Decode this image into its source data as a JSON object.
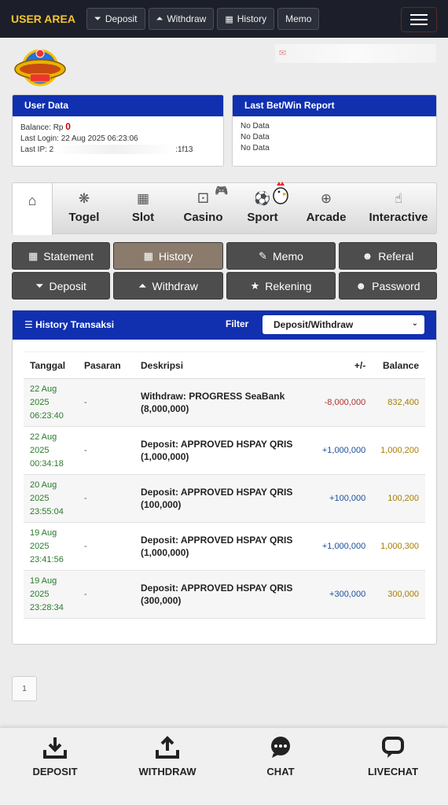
{
  "topbar": {
    "brand": "USER AREA",
    "buttons": [
      {
        "label": "Deposit",
        "icon": "deposit-icon"
      },
      {
        "label": "Withdraw",
        "icon": "withdraw-icon"
      },
      {
        "label": "History",
        "icon": "history-icon"
      },
      {
        "label": "Memo",
        "icon": ""
      }
    ]
  },
  "user_data": {
    "title": "User Data",
    "balance_label": "Balance: Rp",
    "balance_value": "0",
    "last_login": "Last Login: 22 Aug 2025 06:23:06",
    "last_ip_label": "Last IP: 2",
    "last_ip_tail": ":1f13"
  },
  "last_bet": {
    "title": "Last Bet/Win Report",
    "lines": [
      "No Data",
      "No Data",
      "No Data"
    ]
  },
  "categories": [
    {
      "label": "",
      "icon": "home-icon"
    },
    {
      "label": "Togel",
      "icon": "togel-icon"
    },
    {
      "label": "Slot",
      "icon": "slot-icon"
    },
    {
      "label": "Casino",
      "icon": "casino-icon"
    },
    {
      "label": "Sport",
      "icon": "sport-icon"
    },
    {
      "label": "Arcade",
      "icon": "arcade-icon"
    },
    {
      "label": "Interactive",
      "icon": "interactive-icon"
    }
  ],
  "menu": [
    {
      "label": "Statement",
      "icon": "statement-icon"
    },
    {
      "label": "History",
      "icon": "history-icon",
      "active": true
    },
    {
      "label": "Memo",
      "icon": "memo-icon"
    },
    {
      "label": "Referal",
      "icon": "user-icon"
    },
    {
      "label": "Deposit",
      "icon": "deposit-icon"
    },
    {
      "label": "Withdraw",
      "icon": "withdraw-icon"
    },
    {
      "label": "Rekening",
      "icon": "rekening-icon"
    },
    {
      "label": "Password",
      "icon": "user-icon"
    }
  ],
  "history": {
    "title": "History Transaksi",
    "filter_label": "Filter",
    "filter_value": "Deposit/Withdraw",
    "columns": [
      "Tanggal",
      "Pasaran",
      "Deskripsi",
      "+/-",
      "Balance"
    ],
    "rows": [
      {
        "date": [
          "22 Aug",
          "2025",
          "06:23:40"
        ],
        "pasaran": "-",
        "desc": [
          "Withdraw: PROGRESS SeaBank",
          "(8,000,000)"
        ],
        "amount": "-8,000,000",
        "balance": "832,400"
      },
      {
        "date": [
          "22 Aug",
          "2025",
          "00:34:18"
        ],
        "pasaran": "-",
        "desc": [
          "Deposit: APPROVED HSPAY QRIS",
          "(1,000,000)"
        ],
        "amount": "+1,000,000",
        "balance": "1,000,200"
      },
      {
        "date": [
          "20 Aug",
          "2025",
          "23:55:04"
        ],
        "pasaran": "-",
        "desc": [
          "Deposit: APPROVED HSPAY QRIS",
          "(100,000)"
        ],
        "amount": "+100,000",
        "balance": "100,200"
      },
      {
        "date": [
          "19 Aug",
          "2025",
          "23:41:56"
        ],
        "pasaran": "-",
        "desc": [
          "Deposit: APPROVED HSPAY QRIS",
          "(1,000,000)"
        ],
        "amount": "+1,000,000",
        "balance": "1,000,300"
      },
      {
        "date": [
          "19 Aug",
          "2025",
          "23:28:34"
        ],
        "pasaran": "-",
        "desc": [
          "Deposit: APPROVED HSPAY QRIS",
          "(300,000)"
        ],
        "amount": "+300,000",
        "balance": "300,000"
      }
    ]
  },
  "pagination": {
    "current": "1"
  },
  "bottom_nav": [
    {
      "label": "DEPOSIT",
      "icon": "download-icon"
    },
    {
      "label": "WITHDRAW",
      "icon": "upload-icon"
    },
    {
      "label": "CHAT",
      "icon": "chat-icon"
    },
    {
      "label": "LIVECHAT",
      "icon": "livechat-icon"
    }
  ]
}
